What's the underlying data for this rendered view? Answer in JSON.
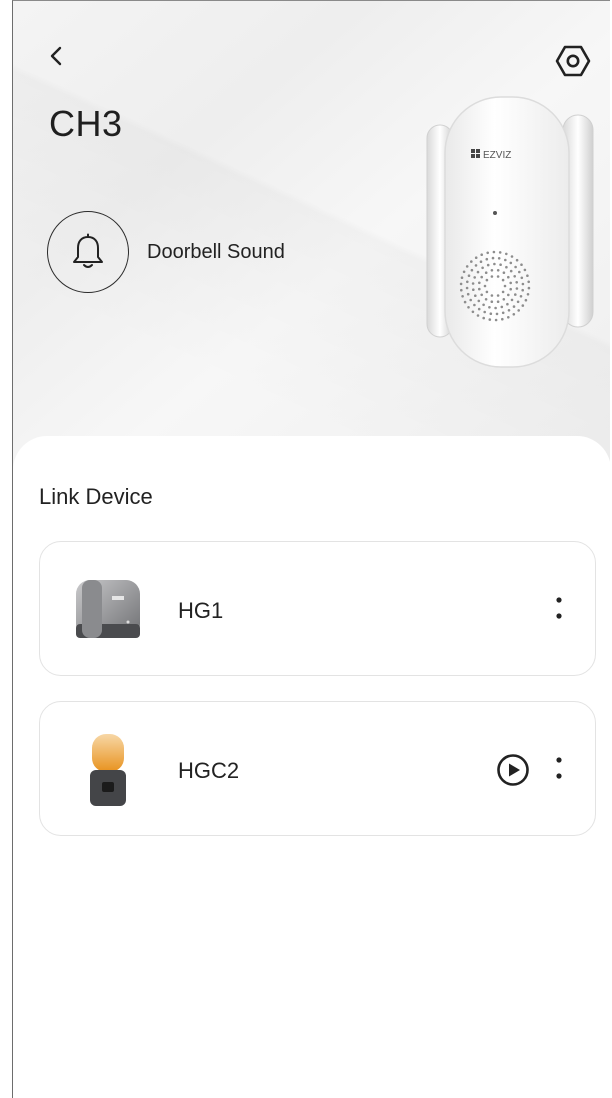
{
  "header": {
    "title": "CH3",
    "back_icon": "chevron-left-icon",
    "settings_icon": "settings-hexagon-icon"
  },
  "hero": {
    "sound_label": "Doorbell Sound",
    "sound_icon": "bell-icon",
    "device_image": "doorbell-chime-device",
    "brand_logo_text": "EZVIZ"
  },
  "link_section": {
    "label": "Link Device",
    "devices": [
      {
        "name": "HG1",
        "thumbnail": "gate-controller-device",
        "has_play": false,
        "more_icon": "more-vertical-icon"
      },
      {
        "name": "HGC2",
        "thumbnail": "warning-light-device",
        "has_play": true,
        "play_icon": "play-circle-icon",
        "more_icon": "more-vertical-icon"
      }
    ]
  },
  "colors": {
    "text": "#222222",
    "card_border": "#e3e3e3",
    "hero_background": "#f2f2f2"
  }
}
